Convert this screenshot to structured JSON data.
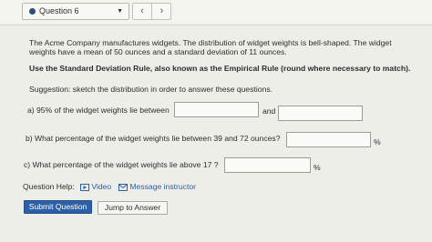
{
  "header": {
    "question_select": "Question 6",
    "prev_symbol": "‹",
    "next_symbol": "›"
  },
  "problem": {
    "intro_line1": "The Acme Company manufactures widgets. The distribution of widget weights is bell-shaped. The widget",
    "intro_line2": "weights have a mean of 50 ounces and a standard deviation of 11 ounces.",
    "instruction": "Use the Standard Deviation Rule, also known as the Empirical Rule (round where necessary to match).",
    "suggestion": "Suggestion: sketch the distribution in order to answer these questions."
  },
  "parts": {
    "a_text": "a) 95% of the widget weights lie between",
    "a_and": "and",
    "a_value1": "",
    "a_value2": "",
    "b_text": "b) What percentage of the widget weights lie between 39 and 72 ounces?",
    "b_value": "",
    "b_unit": "%",
    "c_text": "c) What percentage of the widget weights lie above 17 ?",
    "c_value": "",
    "c_unit": "%"
  },
  "help": {
    "label": "Question Help:",
    "video": "Video",
    "message": "Message instructor"
  },
  "actions": {
    "submit": "Submit Question",
    "jump": "Jump to Answer"
  },
  "colors": {
    "accent": "#2c5fa8",
    "background": "#eeeee9"
  }
}
